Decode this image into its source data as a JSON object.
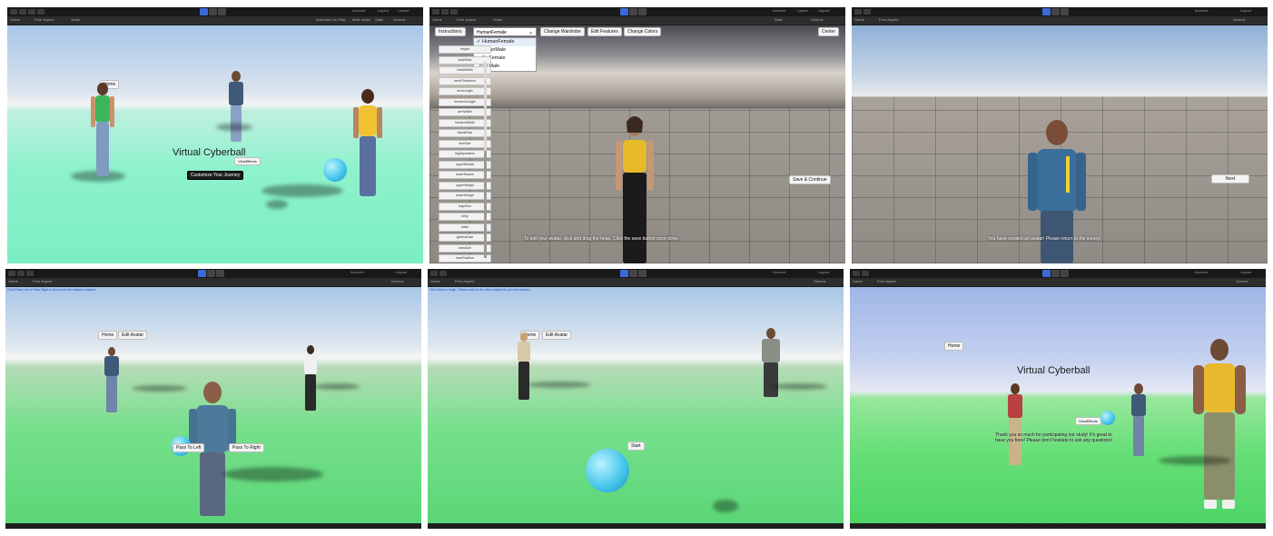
{
  "editor": {
    "play_label": "▶",
    "pause_label": "❚❚",
    "step_label": "▶|",
    "game_tab": "Game",
    "aspect_label": "Free Aspect",
    "scale_label": "Scale",
    "stats_label": "Stats",
    "gizmos_label": "Gizmos",
    "maximize_label": "Maximize On Play",
    "mute_label": "Mute audio",
    "account_label": "Account",
    "layers_label": "Layers",
    "layout_label": "Layout"
  },
  "panel1": {
    "title": "Virtual Cyberball",
    "home_label": "Home",
    "small_label": "ViewEffects",
    "start_label": "Customize Your Journey"
  },
  "panel2": {
    "instructions_label": "Instructions",
    "dropdown_value": "HumanFemale",
    "dropdown_options": [
      "HumanFemale",
      "HumanMale",
      "o3n Female",
      "o3n Male"
    ],
    "change_wardrobe_label": "Change Wardrobe",
    "edit_features_label": "Edit Features",
    "change_colors_label": "Change Colors",
    "center_label": "Center",
    "save_label": "Save & Continue",
    "caption": "To edit your avatar, click and drag the head. Click the save button once done.",
    "sliders": [
      "height",
      "headSize",
      "headWidth",
      "neckThickness",
      "armLength",
      "forearmLength",
      "armWidth",
      "forearmWidth",
      "handsSize",
      "feetSize",
      "legSeparation",
      "upperMuscle",
      "lowerMuscle",
      "upperWeight",
      "lowerWeight",
      "legsSize",
      "belly",
      "waist",
      "gluteusSize",
      "earsSize",
      "earsPosition",
      "earsRotation",
      "noseSize"
    ]
  },
  "panel3": {
    "next_label": "Next",
    "caption": "You have created an avatar! Please return to the survey."
  },
  "panel4": {
    "home_label": "Home",
    "edit_label": "Edit Avatar",
    "pass_left_label": "Pass To Left",
    "pass_right_label": "Pass To Right",
    "top_caption": "Click Pass Left or Pass Right to throw the ball between players"
  },
  "panel5": {
    "home_label": "Home",
    "edit_label": "Edit Avatar",
    "start_label": "Start",
    "top_caption": "Click Start to begin. Please wait for the other players to join the session."
  },
  "panel6": {
    "title": "Virtual Cyberball",
    "home_label": "Home",
    "small_label": "ViewEffects",
    "thanks_caption": "Thank you so much for participating our study! It's great to have you here! Please don't hesitate to ask any questions!"
  },
  "colors": {
    "play_accent": "#3a6ad8",
    "ball": "#42c2ea",
    "ground_green": "#5bd676",
    "ground_mint": "#7ceec2"
  }
}
